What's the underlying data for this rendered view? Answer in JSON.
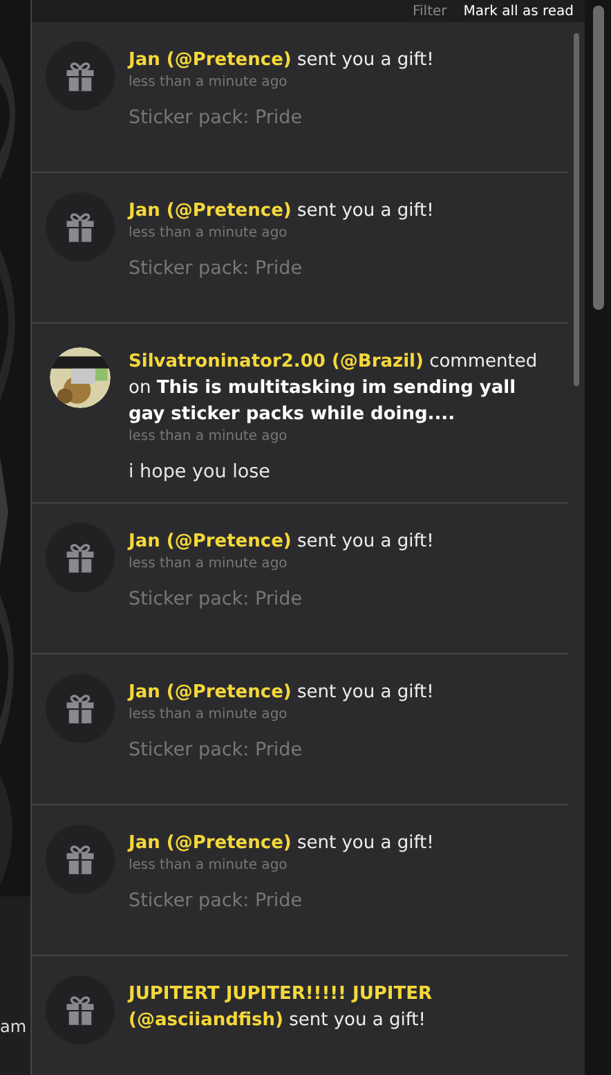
{
  "header": {
    "filter": "Filter",
    "mark_all": "Mark all as read"
  },
  "background": {
    "field_text": "am"
  },
  "notifications": [
    {
      "kind": "gift",
      "author": "Jan (@Pretence)",
      "action": "sent you a gift!",
      "time": "less than a minute ago",
      "body": "Sticker pack: Pride"
    },
    {
      "kind": "gift",
      "author": "Jan (@Pretence)",
      "action": "sent you a gift!",
      "time": "less than a minute ago",
      "body": "Sticker pack: Pride"
    },
    {
      "kind": "comment",
      "author": "Silvatroninator2.00 (@Brazil)",
      "action": "commented on",
      "target": "This is multitasking im sending yall gay sticker packs while doing....",
      "time": "less than a minute ago",
      "body": "i hope you lose"
    },
    {
      "kind": "gift",
      "author": "Jan (@Pretence)",
      "action": "sent you a gift!",
      "time": "less than a minute ago",
      "body": "Sticker pack: Pride"
    },
    {
      "kind": "gift",
      "author": "Jan (@Pretence)",
      "action": "sent you a gift!",
      "time": "less than a minute ago",
      "body": "Sticker pack: Pride"
    },
    {
      "kind": "gift",
      "author": "Jan (@Pretence)",
      "action": "sent you a gift!",
      "time": "less than a minute ago",
      "body": "Sticker pack: Pride"
    },
    {
      "kind": "gift",
      "author": "JUPITERT JUPITER!!!!! JUPITER (@asciiandfish)",
      "action": "sent you a gift!"
    }
  ]
}
